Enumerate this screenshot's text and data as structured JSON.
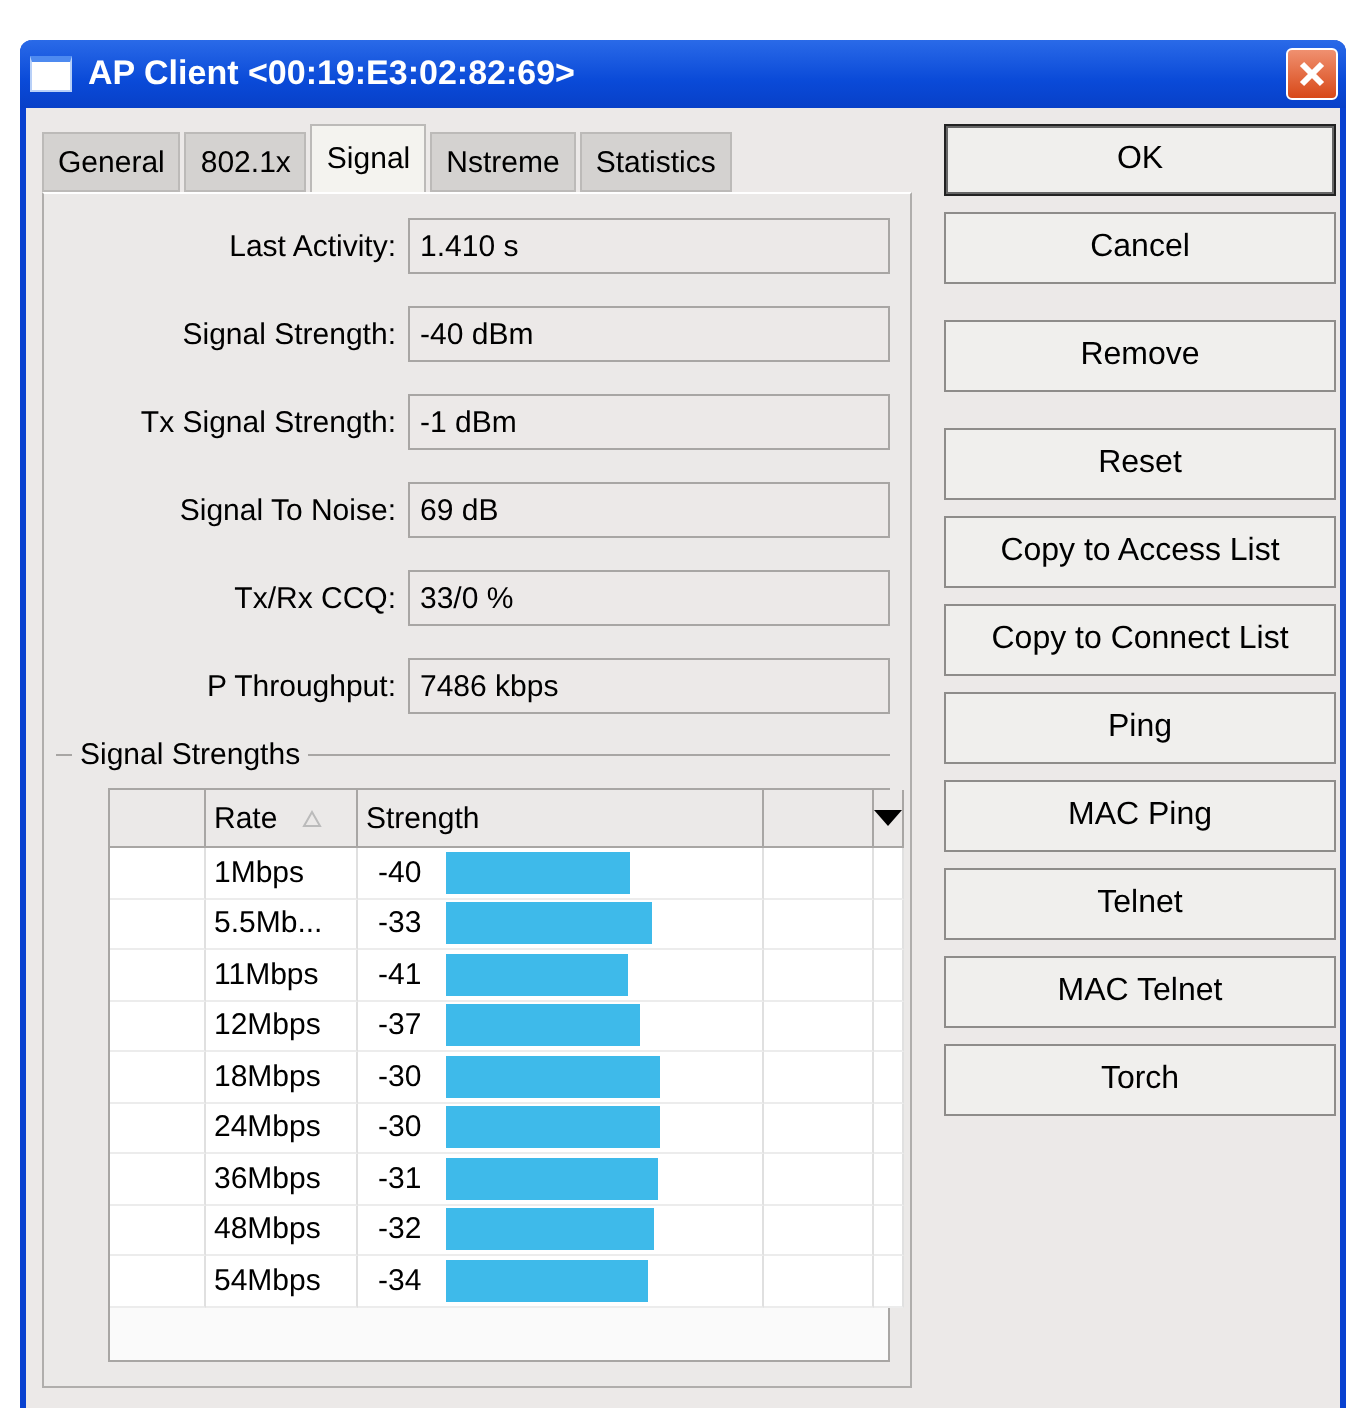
{
  "window": {
    "title": "AP Client <00:19:E3:02:82:69>"
  },
  "tabs": [
    {
      "label": "General",
      "selected": false
    },
    {
      "label": "802.1x",
      "selected": false
    },
    {
      "label": "Signal",
      "selected": true
    },
    {
      "label": "Nstreme",
      "selected": false
    },
    {
      "label": "Statistics",
      "selected": false
    }
  ],
  "fields": [
    {
      "label": "Last Activity:",
      "value": "1.410 s"
    },
    {
      "label": "Signal Strength:",
      "value": "-40 dBm"
    },
    {
      "label": "Tx Signal Strength:",
      "value": "-1 dBm"
    },
    {
      "label": "Signal To Noise:",
      "value": "69 dB"
    },
    {
      "label": "Tx/Rx CCQ:",
      "value": "33/0 %"
    },
    {
      "label": "P Throughput:",
      "value": "7486 kbps"
    }
  ],
  "signal_strengths": {
    "title": "Signal Strengths",
    "columns": [
      "Rate",
      "Strength"
    ],
    "rows": [
      {
        "rate": "1Mbps",
        "strength": "-40"
      },
      {
        "rate": "5.5Mb...",
        "strength": "-33"
      },
      {
        "rate": "11Mbps",
        "strength": "-41"
      },
      {
        "rate": "12Mbps",
        "strength": "-37"
      },
      {
        "rate": "18Mbps",
        "strength": "-30"
      },
      {
        "rate": "24Mbps",
        "strength": "-30"
      },
      {
        "rate": "36Mbps",
        "strength": "-31"
      },
      {
        "rate": "48Mbps",
        "strength": "-32"
      },
      {
        "rate": "54Mbps",
        "strength": "-34"
      }
    ]
  },
  "button_groups": [
    [
      "OK",
      "Cancel"
    ],
    [
      "Remove"
    ],
    [
      "Reset",
      "Copy to Access List",
      "Copy to Connect List",
      "Ping",
      "MAC Ping",
      "Telnet",
      "MAC Telnet",
      "Torch"
    ]
  ]
}
